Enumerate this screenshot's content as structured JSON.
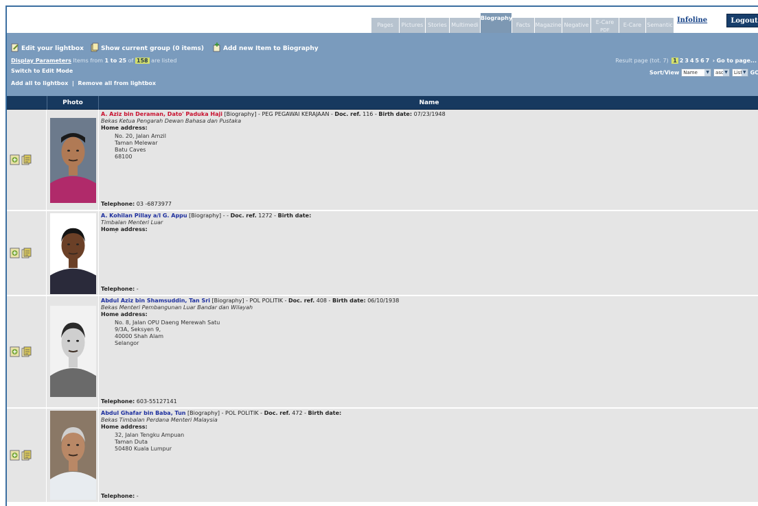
{
  "tabs": [
    {
      "label": "Pages",
      "active": false
    },
    {
      "label": "Pictures",
      "active": false
    },
    {
      "label": "Stories",
      "active": false
    },
    {
      "label": "Multimedi",
      "active": false
    },
    {
      "label": "Biography",
      "active": true
    },
    {
      "label": "Facts",
      "active": false
    },
    {
      "label": "Magazine",
      "active": false
    },
    {
      "label": "Negative",
      "active": false
    },
    {
      "label": "E-Care",
      "sub": "PDF",
      "active": false
    },
    {
      "label": "E-Care",
      "active": false
    },
    {
      "label": "Semantic",
      "active": false
    }
  ],
  "header": {
    "infoline": "Infoline",
    "logout": "Logout"
  },
  "toolbar": {
    "edit_lightbox": "Edit your lightbox",
    "show_group": "Show current group (0 items)",
    "add_item": "Add new Item to Biography",
    "display_params": "Display Parameters",
    "items_prefix": "Items from",
    "items_range": "1 to 25",
    "items_of": "of",
    "items_total": "158",
    "items_suffix": "are listed",
    "switch_edit": "Switch to Edit Mode",
    "add_all": "Add all to lightbox",
    "sep": "|",
    "remove_all": "Remove all from lightbox"
  },
  "pager": {
    "label": "Result page",
    "total": "(tot. 7)",
    "pages": [
      "1",
      "2",
      "3",
      "4",
      "5",
      "6",
      "7"
    ],
    "current": "1",
    "next": "›",
    "goto": "Go to page..."
  },
  "sortview": {
    "label": "Sort/View",
    "sort_field": "Name",
    "sort_order": "asc",
    "view": "List",
    "go": "GO"
  },
  "table": {
    "col_photo": "Photo",
    "col_name": "Name",
    "labels": {
      "doc_ref": "Doc. ref.",
      "birth_date": "Birth date:",
      "home_address": "Home address:",
      "telephone": "Telephone:"
    },
    "rows": [
      {
        "name": "A. Aziz bin Deraman, Dato' Paduka Haji",
        "name_color": "red",
        "type": "[Biography]",
        "category": "- PEG PEGAWAI KERAJAAN -",
        "doc_ref": "116",
        "birth_date": "07/23/1948",
        "description": "Bekas Ketua Pengarah Dewan Bahasa dan Pustaka",
        "address": [
          "No. 20, Jalan Amzil",
          "Taman Melewar",
          "Batu Caves",
          "68100"
        ],
        "telephone": "03 -6873977"
      },
      {
        "name": "A. Kohilan Pillay a/l G. Appu",
        "name_color": "blue",
        "type": "[Biography]",
        "category": "- -",
        "doc_ref": "1272",
        "birth_date": "",
        "description": "Timbalan Menteri Luar",
        "address": [
          "-"
        ],
        "telephone": "-"
      },
      {
        "name": "Abdul Aziz bin Shamsuddin, Tan Sri",
        "name_color": "blue",
        "type": "[Biography]",
        "category": "- POL POLITIK -",
        "doc_ref": "408",
        "birth_date": "06/10/1938",
        "description": "Bekas Menteri Pembangunan Luar Bandar dan Wilayah",
        "address": [
          "No. 8, Jalan OPU Daeng Merewah Satu",
          "9/3A, Seksyen 9,",
          "40000 Shah Alam",
          "Selangor"
        ],
        "telephone": "603-55127141"
      },
      {
        "name": "Abdul Ghafar bin Baba, Tun",
        "name_color": "blue",
        "type": "[Biography]",
        "category": "- POL POLITIK -",
        "doc_ref": "472",
        "birth_date": "",
        "description": "Bekas Timbalan Perdana Menteri Malaysia",
        "address": [
          "32, Jalan Tengku Ampuan",
          "Taman Duta",
          "50480 Kuala Lumpur"
        ],
        "telephone": "-"
      }
    ]
  },
  "colors": {
    "panel": "#7a9bbd",
    "header": "#17395f",
    "row": "#e5e5e5",
    "name_red": "#c8102e",
    "name_blue": "#1d2f9e"
  },
  "icons": {
    "row_actions": [
      "lightbox-add-icon",
      "edit-document-icon"
    ]
  }
}
